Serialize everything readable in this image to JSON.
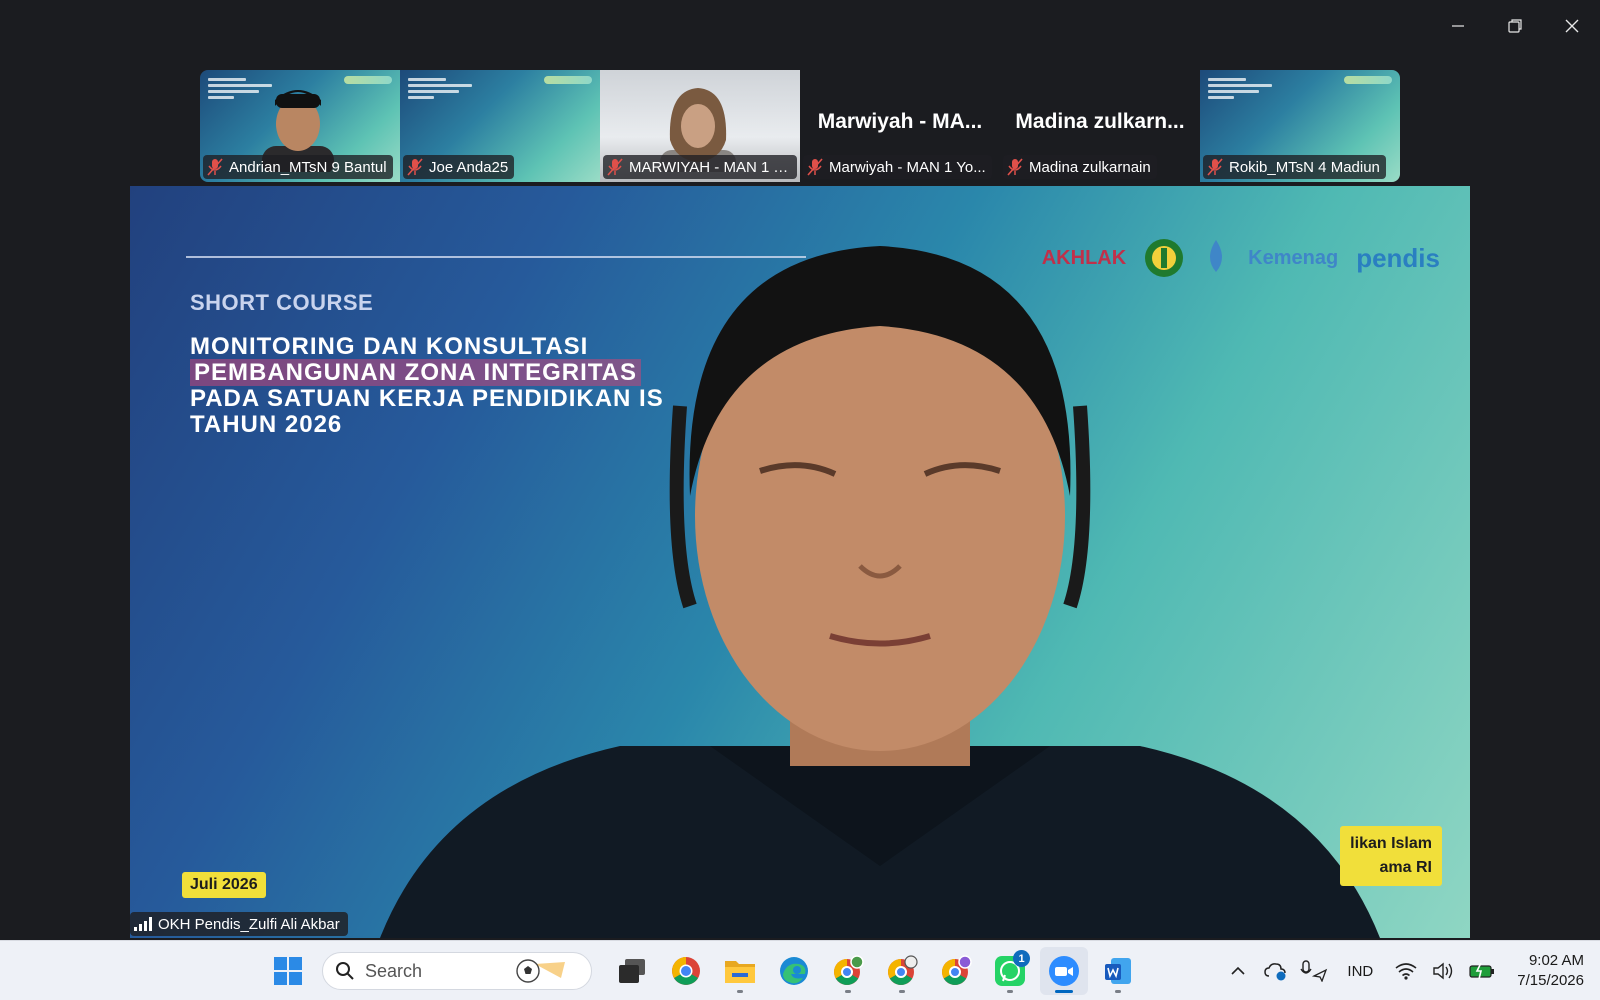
{
  "window": {
    "controls": [
      "minimize",
      "restore",
      "close"
    ]
  },
  "participants": [
    {
      "name": "Andrian_MTsN 9 Bantul",
      "type": "video-slide-person",
      "muted": true
    },
    {
      "name": "Joe Anda25",
      "type": "video-slide",
      "muted": true
    },
    {
      "name": "MARWIYAH - MAN 1 Y...",
      "type": "camera",
      "muted": true
    },
    {
      "name": "Marwiyah - MAN 1 Yo...",
      "display_name": "Marwiyah - MA...",
      "type": "name-only",
      "muted": true
    },
    {
      "name": "Madina zulkarnain",
      "display_name": "Madina zulkarn...",
      "type": "name-only",
      "muted": true
    },
    {
      "name": "Rokib_MTsN 4 Madiun",
      "type": "video-slide",
      "muted": true
    }
  ],
  "main_video": {
    "speaker_name": "OKH Pendis_Zulfi Ali Akbar",
    "slide": {
      "kicker": "SHORT COURSE",
      "title_line1": "MONITORING DAN KONSULTASI",
      "title_line2": "PEMBANGUNAN ZONA INTEGRITAS",
      "title_line3": "PADA SATUAN KERJA PENDIDIKAN IS",
      "title_line4": "TAHUN 2026",
      "date_badge": "Juli 2026",
      "footer_line1": "likan Islam",
      "footer_line2": "ama RI",
      "logos": [
        "AKHLAK",
        "Kemenag",
        "pendis"
      ]
    }
  },
  "taskbar": {
    "search_placeholder": "Search",
    "apps": [
      "start",
      "search",
      "task-view",
      "chrome",
      "file-explorer",
      "edge",
      "chrome-profile-1",
      "chrome-profile-2",
      "chrome-profile-3",
      "whatsapp",
      "zoom",
      "word"
    ],
    "whatsapp_badge": "1",
    "language": "IND",
    "time": "9:02 AM",
    "date": "7/15/2026"
  }
}
